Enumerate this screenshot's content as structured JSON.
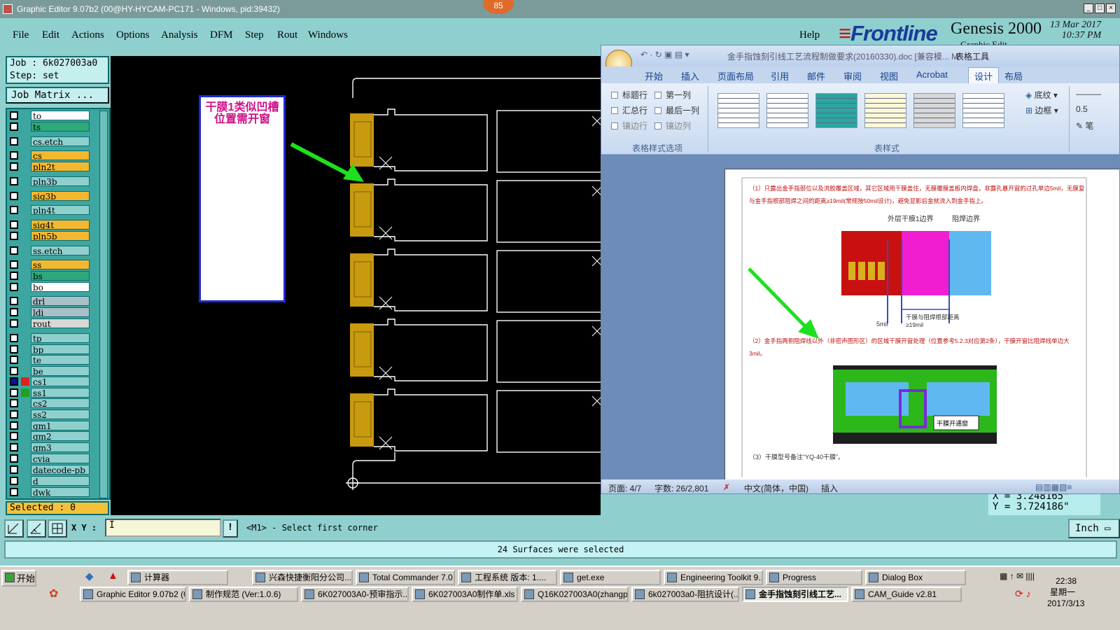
{
  "window": {
    "title": "Graphic Editor 9.07b2 (00@HY-HYCAM-PC171 - Windows, pid:39432)",
    "badge": "85"
  },
  "menu": {
    "items": [
      "File",
      "Edit",
      "Actions",
      "Options",
      "Analysis",
      "DFM",
      "Step",
      "Rout",
      "Windows"
    ],
    "help": "Help"
  },
  "brand": {
    "logo": "Frontline",
    "product": "Genesis 2000",
    "subtitle": "Graphic Edit",
    "date": "13 Mar 2017",
    "time": "10:37 PM"
  },
  "job": {
    "job_line": "Job : 6k027003a0",
    "step_line": "Step: set",
    "matrix_button": "Job Matrix ..."
  },
  "layers": [
    {
      "name": "to",
      "color": "#ffffff"
    },
    {
      "name": "ts",
      "color": "#2fa87a"
    },
    {
      "name": "cs.etch",
      "color": "#8fd0cf"
    },
    {
      "name": "cs",
      "color": "#f4b830"
    },
    {
      "name": "pln2t",
      "color": "#f4b830"
    },
    {
      "name": "pln3b",
      "color": "#8fd0cf"
    },
    {
      "name": "sig3b",
      "color": "#f4b830"
    },
    {
      "name": "pln4t",
      "color": "#8fd0cf"
    },
    {
      "name": "sig4t",
      "color": "#f4b830"
    },
    {
      "name": "pln5b",
      "color": "#f4b830"
    },
    {
      "name": "ss.etch",
      "color": "#8fd0cf"
    },
    {
      "name": "ss",
      "color": "#f4b830"
    },
    {
      "name": "bs",
      "color": "#2fa87a"
    },
    {
      "name": "bo",
      "color": "#ffffff"
    },
    {
      "name": "drl",
      "color": "#aac0c8"
    },
    {
      "name": "ldi",
      "color": "#aac0c8"
    },
    {
      "name": "rout",
      "color": "#d8d8d8"
    },
    {
      "name": "tp",
      "color": "#8fd0cf"
    },
    {
      "name": "bp",
      "color": "#8fd0cf"
    },
    {
      "name": "te",
      "color": "#8fd0cf"
    },
    {
      "name": "be",
      "color": "#8fd0cf"
    },
    {
      "name": "cs1",
      "color": "#8fd0cf",
      "swatch": "#e02020",
      "marker": "#1010a0"
    },
    {
      "name": "ss1",
      "color": "#8fd0cf",
      "swatch": "#20a020"
    },
    {
      "name": "cs2",
      "color": "#8fd0cf"
    },
    {
      "name": "ss2",
      "color": "#8fd0cf"
    },
    {
      "name": "gm1",
      "color": "#8fd0cf"
    },
    {
      "name": "gm2",
      "color": "#8fd0cf"
    },
    {
      "name": "gm3",
      "color": "#8fd0cf"
    },
    {
      "name": "cvia",
      "color": "#8fd0cf"
    },
    {
      "name": "datecode-pb",
      "color": "#8fd0cf"
    },
    {
      "name": "d",
      "color": "#8fd0cf"
    },
    {
      "name": "dwk",
      "color": "#8fd0cf"
    }
  ],
  "selected_label": "Selected : 0",
  "canvas": {
    "note": "干膜1类似凹槽位置需开窗"
  },
  "coords": {
    "x": "X = 3.248165\"",
    "y": "Y = 3.724186\""
  },
  "word": {
    "title": "金手指蚀刻引线工艺流程制做要求(20160330).doc [兼容模... M",
    "table_tools": "表格工具",
    "tabs": [
      "开始",
      "插入",
      "页面布局",
      "引用",
      "邮件",
      "审阅",
      "视图",
      "Acrobat",
      "设计",
      "布局"
    ],
    "style_options": [
      "标题行",
      "第一列",
      "汇总行",
      "最后一列",
      "镶边行",
      "镶边列"
    ],
    "group_labels": [
      "表格样式选项",
      "表样式"
    ],
    "shading": "底纹",
    "borders": "边框",
    "pen_width": "0.5",
    "pen": "笔",
    "doc_text": {
      "p1": "（1）只露出金手指部位以及流胶覆盖区域，其它区域用干膜盖住，无膜覆膜盖板内焊盘，非露孔暴开窗的过孔单边5mil，无膜复与金手指根部阻焊之间的距离≥19mil(常规按50mil设计)，避免显影后金就流入到金手指上。",
      "fig1_label1": "外层干膜1边界",
      "fig1_label2": "阻焊边界",
      "fig1_dim1": "5mil",
      "fig1_dim2": "干膜与阻焊根部距离≥19mil",
      "p2": "（2）金手指两侧阻焊线以外（非密声图形区）的区域干膜开窗处理（位置参考5.2.3对应第2条），干膜开窗比阻焊线单边大3mil。",
      "fig2_label": "干膜开通窗",
      "p3": "（3）干膜型号备注“YQ-40干膜”。"
    },
    "status": {
      "page": "页面: 4/7",
      "words": "字数: 26/2,801",
      "lang": "中文(简体，中国)",
      "mode": "插入"
    }
  },
  "command": {
    "xy_label": "X Y :",
    "input_value": "I",
    "prompt": "<M1> - Select first corner",
    "unit": "Inch"
  },
  "status_message": "24 Surfaces were selected",
  "taskbar": {
    "start": "开始",
    "row1": [
      "计算器",
      "兴森快捷衡阳分公司...",
      "Total Commander 7.0 ...",
      "工程系统  版本: 1....",
      "get.exe",
      "Engineering Toolkit 9....",
      "Progress",
      "Dialog Box"
    ],
    "row2": [
      "Graphic Editor 9.07b2 (0...",
      "制作规范 (Ver:1.0.6)",
      "6K027003A0-预审指示....",
      "6K027003A0制作单.xls ...",
      "Q16K027003A0(zhangp)...",
      "6k027003a0-阻抗设计(...",
      "金手指蚀刻引线工艺...",
      "CAM_Guide v2.81"
    ],
    "time": "22:38",
    "weekday": "星期一",
    "date": "2017/3/13"
  }
}
